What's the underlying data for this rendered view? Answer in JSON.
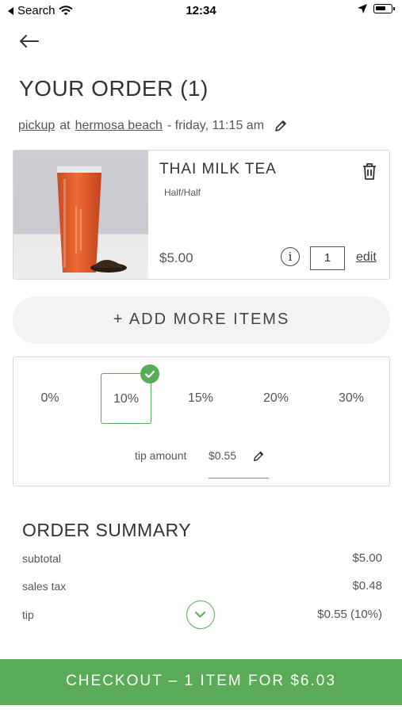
{
  "status_bar": {
    "back_app": "Search",
    "time": "12:34",
    "battery_level": 0.7
  },
  "nav": {
    "back_icon": "arrow-left-icon"
  },
  "order": {
    "title": "YOUR ORDER (1)",
    "pickup_label": "pickup",
    "at": "at",
    "location": "hermosa beach",
    "time_text": "- friday, 11:15 am"
  },
  "item": {
    "name": "THAI MILK TEA",
    "option": "Half/Half",
    "price": "$5.00",
    "quantity": "1",
    "edit_label": "edit",
    "info_label": "i"
  },
  "add_more_label": "+ ADD MORE ITEMS",
  "tip": {
    "options": [
      "0%",
      "10%",
      "15%",
      "20%",
      "30%"
    ],
    "selected_index": 1,
    "amount_label": "tip amount",
    "amount_value": "$0.55"
  },
  "summary": {
    "title": "ORDER SUMMARY",
    "rows": [
      {
        "label": "subtotal",
        "value": "$5.00"
      },
      {
        "label": "sales tax",
        "value": "$0.48"
      },
      {
        "label": "tip",
        "value": "$0.55 (10%)"
      }
    ]
  },
  "checkout_label": "CHECKOUT – 1 ITEM FOR $6.03",
  "colors": {
    "accent": "#5aab58",
    "text": "#333333",
    "border": "#d9d9d9",
    "button_bg": "#f3f3f6"
  }
}
